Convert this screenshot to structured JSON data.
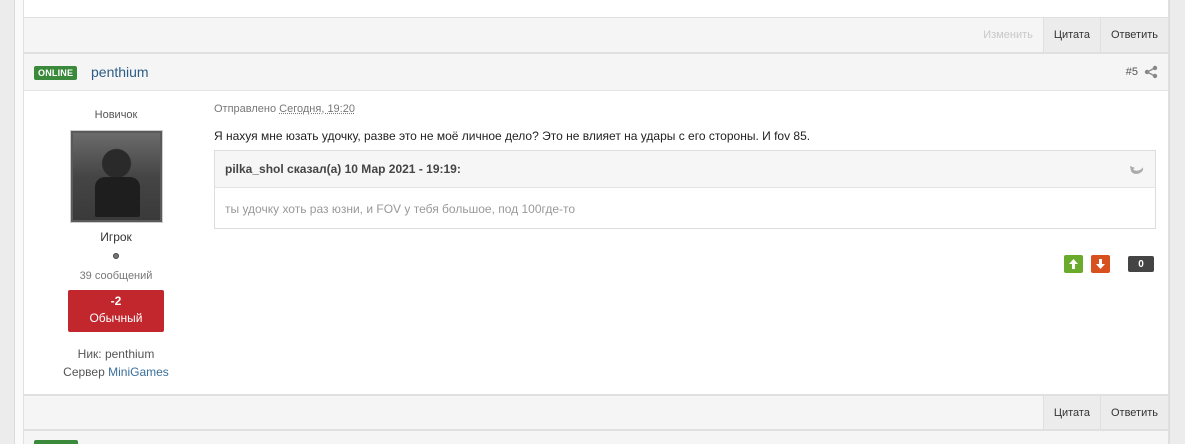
{
  "top_controls": {
    "edit_label": "Изменить",
    "quote_label": "Цитата",
    "reply_label": "Ответить"
  },
  "post": {
    "online_badge": "ONLINE",
    "author": "penthium",
    "number": "#5",
    "rank_title": "Новичок",
    "group": "Игрок",
    "posts_count": "39 сообщений",
    "reputation": {
      "value": "-2",
      "label": "Обычный",
      "color": "#c1272d"
    },
    "nick_line": "Ник: penthium",
    "server_label": "Сервер",
    "server_name": "MiniGames",
    "meta_prefix": "Отправлено",
    "meta_date": "Сегодня, 19:20",
    "text": "Я нахуя мне юзать удочку, разве это не моё личное дело? Это не влияет на удары с его стороны. И fov 85.",
    "quote": {
      "cite": "pilka_shol сказал(а) 10 Мар 2021 - 19:19:",
      "body": "ты удочку хоть раз юзни, и FOV у тебя большое, под 100где-то"
    },
    "votes": {
      "count": "0",
      "up_color": "#6aab2b",
      "down_color": "#d9501f"
    }
  },
  "bottom_controls": {
    "quote_label": "Цитата",
    "reply_label": "Ответить"
  }
}
